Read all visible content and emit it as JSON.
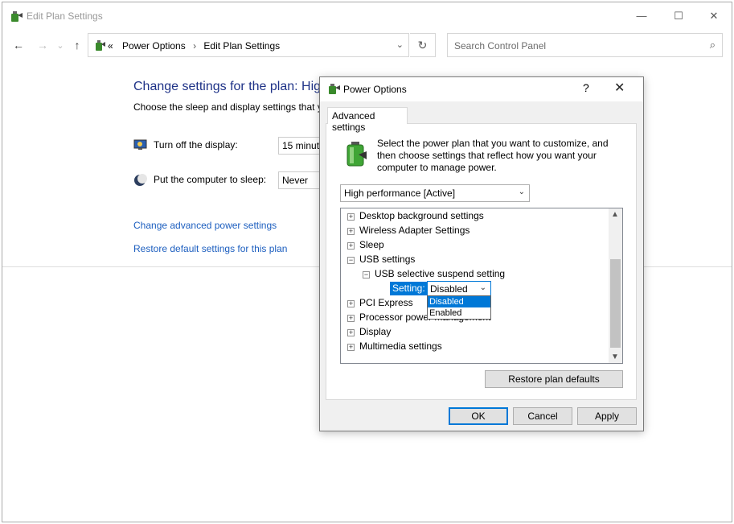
{
  "window": {
    "title": "Edit Plan Settings",
    "controls": {
      "minimize": "—",
      "maximize": "☐",
      "close": "✕"
    }
  },
  "nav": {
    "back": "←",
    "forward": "→",
    "recent": "⌄",
    "up": "↑",
    "breadcrumb": {
      "prefix": "«",
      "items": [
        "Power Options",
        "Edit Plan Settings"
      ],
      "separator": "›"
    },
    "address_dropdown": "⌄",
    "refresh": "↻",
    "search": {
      "placeholder": "Search Control Panel",
      "icon": "⌕"
    }
  },
  "page": {
    "title": "Change settings for the plan: High",
    "subtitle": "Choose the sleep and display settings that y",
    "display": {
      "label": "Turn off the display:",
      "value": "15 minut",
      "icon": "display-icon"
    },
    "sleep": {
      "label": "Put the computer to sleep:",
      "value": "Never",
      "icon": "moon-icon"
    },
    "links": {
      "advanced": "Change advanced power settings",
      "restore": "Restore default settings for this plan"
    }
  },
  "dialog": {
    "title": "Power Options",
    "help": "?",
    "close": "✕",
    "tab": "Advanced settings",
    "intro": "Select the power plan that you want to customize, and then choose settings that reflect how you want your computer to manage power.",
    "plan": {
      "selected": "High performance [Active]",
      "arrow": "⌄"
    },
    "tree": {
      "items": [
        {
          "label": "Desktop background settings",
          "exp": "+"
        },
        {
          "label": "Wireless Adapter Settings",
          "exp": "+"
        },
        {
          "label": "Sleep",
          "exp": "+"
        },
        {
          "label": "USB settings",
          "exp": "−"
        },
        {
          "label": "USB selective suspend setting",
          "exp": "−"
        },
        {
          "label": "PCI Express",
          "exp": "+"
        },
        {
          "label": "Processor power management",
          "exp": "+"
        },
        {
          "label": "Display",
          "exp": "+"
        },
        {
          "label": "Multimedia settings",
          "exp": "+"
        }
      ],
      "setting_label": "Setting:",
      "setting_value": "Disabled",
      "setting_arrow": "⌄",
      "options": [
        "Disabled",
        "Enabled"
      ],
      "scroll_up": "▲",
      "scroll_down": "▼"
    },
    "restore_label": "Restore plan defaults",
    "buttons": {
      "ok": "OK",
      "cancel": "Cancel",
      "apply": "Apply"
    }
  },
  "colors": {
    "link": "#1c5ebf",
    "title": "#1e3287",
    "accent": "#0078d7"
  }
}
